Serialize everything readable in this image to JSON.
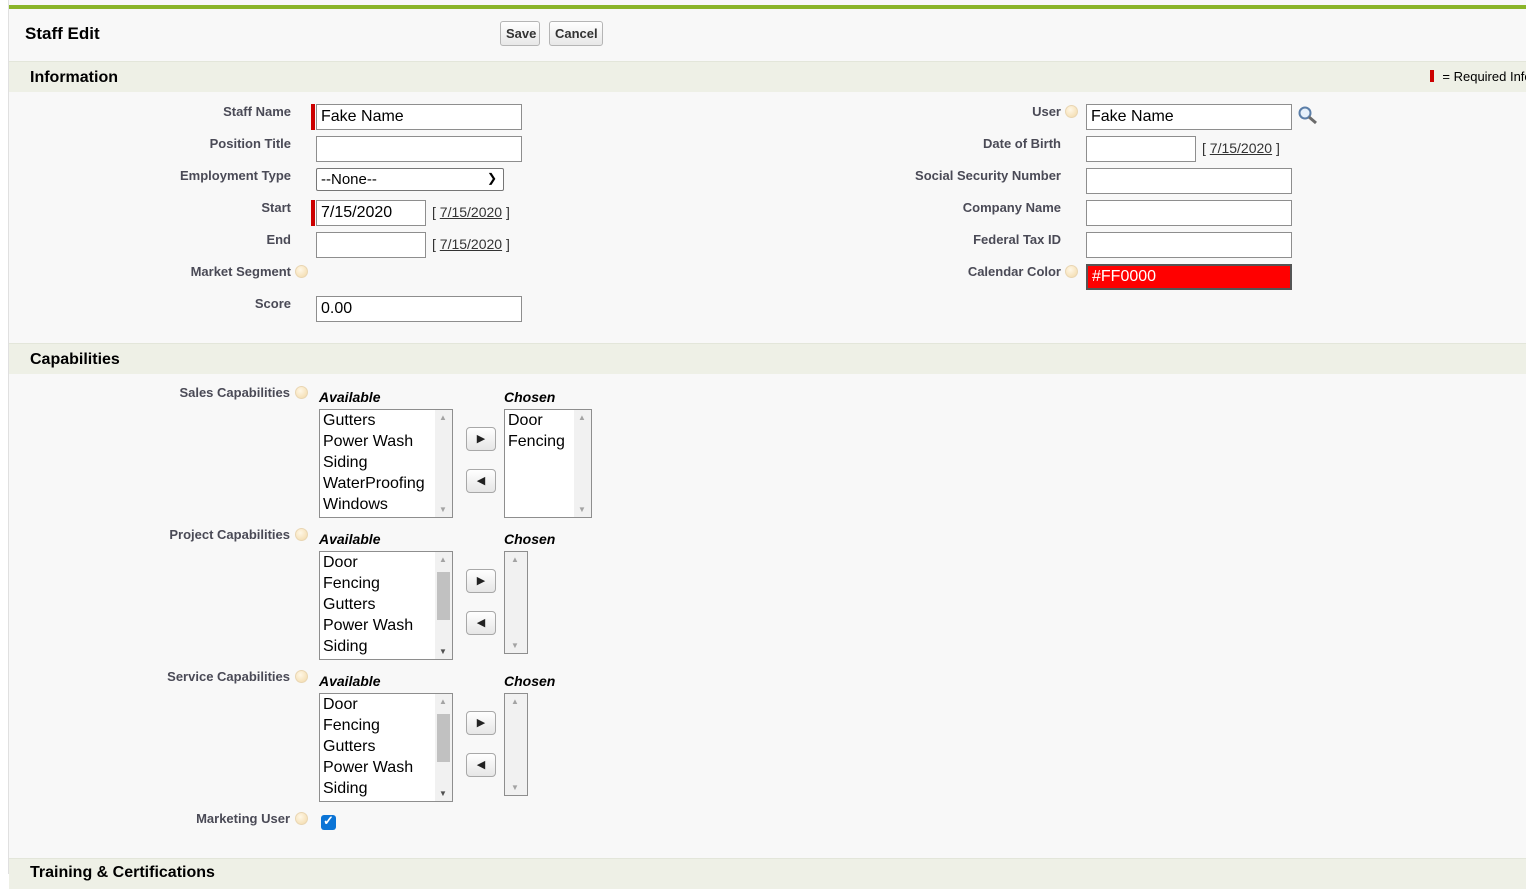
{
  "header": {
    "title": "Staff Edit",
    "save_label": "Save",
    "cancel_label": "Cancel"
  },
  "sections": {
    "information": "Information",
    "capabilities": "Capabilities",
    "training": "Training & Certifications"
  },
  "required_note": "= Required Information",
  "fields": {
    "staff_name": {
      "label": "Staff Name",
      "value": "Fake Name"
    },
    "position_title": {
      "label": "Position Title",
      "value": ""
    },
    "employment_type": {
      "label": "Employment Type",
      "value": "--None--"
    },
    "start": {
      "label": "Start",
      "value": "7/15/2020",
      "date_link": "7/15/2020"
    },
    "end": {
      "label": "End",
      "value": "",
      "date_link": "7/15/2020"
    },
    "market_segment": {
      "label": "Market Segment"
    },
    "score": {
      "label": "Score",
      "value": "0.00"
    },
    "user": {
      "label": "User",
      "value": "Fake Name"
    },
    "date_of_birth": {
      "label": "Date of Birth",
      "value": "",
      "date_link": "7/15/2020"
    },
    "ssn": {
      "label": "Social Security Number",
      "value": ""
    },
    "company_name": {
      "label": "Company Name",
      "value": ""
    },
    "federal_tax_id": {
      "label": "Federal Tax ID",
      "value": ""
    },
    "calendar_color": {
      "label": "Calendar Color",
      "value": "#FF0000",
      "color": "#FF0000"
    }
  },
  "capabilities": {
    "available_label": "Available",
    "chosen_label": "Chosen",
    "sales": {
      "label": "Sales Capabilities",
      "available": [
        "Gutters",
        "Power Wash",
        "Siding",
        "WaterProofing",
        "Windows"
      ],
      "chosen": [
        "Door",
        "Fencing"
      ]
    },
    "project": {
      "label": "Project Capabilities",
      "available": [
        "Door",
        "Fencing",
        "Gutters",
        "Power Wash",
        "Siding"
      ],
      "chosen": []
    },
    "service": {
      "label": "Service Capabilities",
      "available": [
        "Door",
        "Fencing",
        "Gutters",
        "Power Wash",
        "Siding"
      ],
      "chosen": []
    },
    "marketing_user": {
      "label": "Marketing User",
      "checked": true
    }
  },
  "colors": {
    "accent": "#8ab529",
    "required": "#cc0000",
    "section_bg": "#eef0e6",
    "checkbox": "#0b74d6"
  }
}
